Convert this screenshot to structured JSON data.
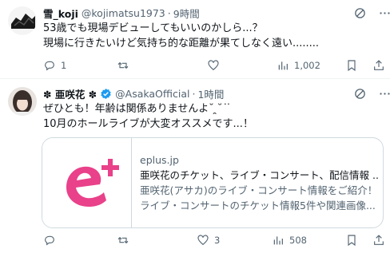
{
  "tweet1": {
    "name": "雪_koji",
    "handle": "@kojimatsu1973",
    "time": "9時間",
    "line1": "53歳でも現場デビューしてもいいのかしら...？",
    "line2": "現場に行きたいけど気持ち的な距離が果てしなく遠い........",
    "replies": "1",
    "retweets": "",
    "likes": "",
    "views": "1,002"
  },
  "tweet2": {
    "name": "✽ 亜咲花 ✽",
    "handle": "@AsakaOfficial",
    "time": "1時間",
    "line1": "ぜひとも！年齢は関係ありませんよ˘ ̯˘ ͘ ͘",
    "line2": "10月のホールライブが大変オススメです...！",
    "replies": "",
    "retweets": "",
    "likes": "3",
    "views": "508",
    "card": {
      "domain": "eplus.jp",
      "title": "亜咲花のチケット、ライブ・コンサート、配信情報 ...",
      "desc1": "亜咲花(アサカ)のライブ・コンサート情報をご紹介！",
      "desc2": "ライブ・コンサートのチケット情報5件や関連画像..."
    }
  },
  "colors": {
    "text": "#0f1419",
    "muted": "#536471",
    "verified": "#1d9bf0",
    "eplus_pink": "#e9418a"
  },
  "icons": [
    "grok-icon",
    "more-icon",
    "reply-icon",
    "retweet-icon",
    "like-icon",
    "views-icon",
    "bookmark-icon",
    "share-icon",
    "verified-icon"
  ]
}
